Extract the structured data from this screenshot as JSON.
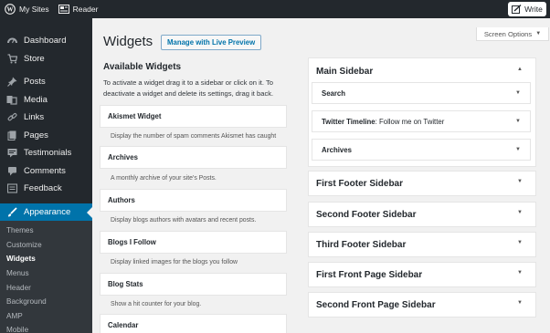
{
  "topbar": {
    "my_sites": "My Sites",
    "reader": "Reader",
    "write": "Write"
  },
  "sidebar": {
    "items": [
      {
        "label": "Dashboard",
        "icon": "dashboard-icon"
      },
      {
        "label": "Store",
        "icon": "cart-icon"
      },
      {
        "label": "Posts",
        "icon": "pin-icon"
      },
      {
        "label": "Media",
        "icon": "media-icon"
      },
      {
        "label": "Links",
        "icon": "link-icon"
      },
      {
        "label": "Pages",
        "icon": "pages-icon"
      },
      {
        "label": "Testimonials",
        "icon": "testimonials-icon"
      },
      {
        "label": "Comments",
        "icon": "comments-icon"
      },
      {
        "label": "Feedback",
        "icon": "feedback-icon"
      },
      {
        "label": "Appearance",
        "icon": "brush-icon"
      }
    ],
    "submenu": [
      "Themes",
      "Customize",
      "Widgets",
      "Menus",
      "Header",
      "Background",
      "AMP",
      "Mobile"
    ]
  },
  "header": {
    "title": "Widgets",
    "live_preview": "Manage with Live Preview",
    "screen_options": "Screen Options"
  },
  "available": {
    "title": "Available Widgets",
    "description": "To activate a widget drag it to a sidebar or click on it. To deactivate a widget and delete its settings, drag it back.",
    "widgets": [
      {
        "name": "Akismet Widget",
        "desc": "Display the number of spam comments Akismet has caught"
      },
      {
        "name": "Archives",
        "desc": "A monthly archive of your site's Posts."
      },
      {
        "name": "Authors",
        "desc": "Display blogs authors with avatars and recent posts."
      },
      {
        "name": "Blogs I Follow",
        "desc": "Display linked images for the blogs you follow"
      },
      {
        "name": "Blog Stats",
        "desc": "Show a hit counter for your blog."
      },
      {
        "name": "Calendar",
        "desc": ""
      }
    ]
  },
  "sidebars": {
    "main": {
      "title": "Main Sidebar",
      "widgets": [
        {
          "name": "Search",
          "suffix": ""
        },
        {
          "name": "Twitter Timeline",
          "suffix": ": Follow me on Twitter"
        },
        {
          "name": "Archives",
          "suffix": ""
        }
      ]
    },
    "others": [
      "First Footer Sidebar",
      "Second Footer Sidebar",
      "Third Footer Sidebar",
      "First Front Page Sidebar",
      "Second Front Page Sidebar"
    ]
  },
  "colors": {
    "admin_dark": "#23282d",
    "accent": "#0073aa",
    "background": "#f1f1f1"
  }
}
